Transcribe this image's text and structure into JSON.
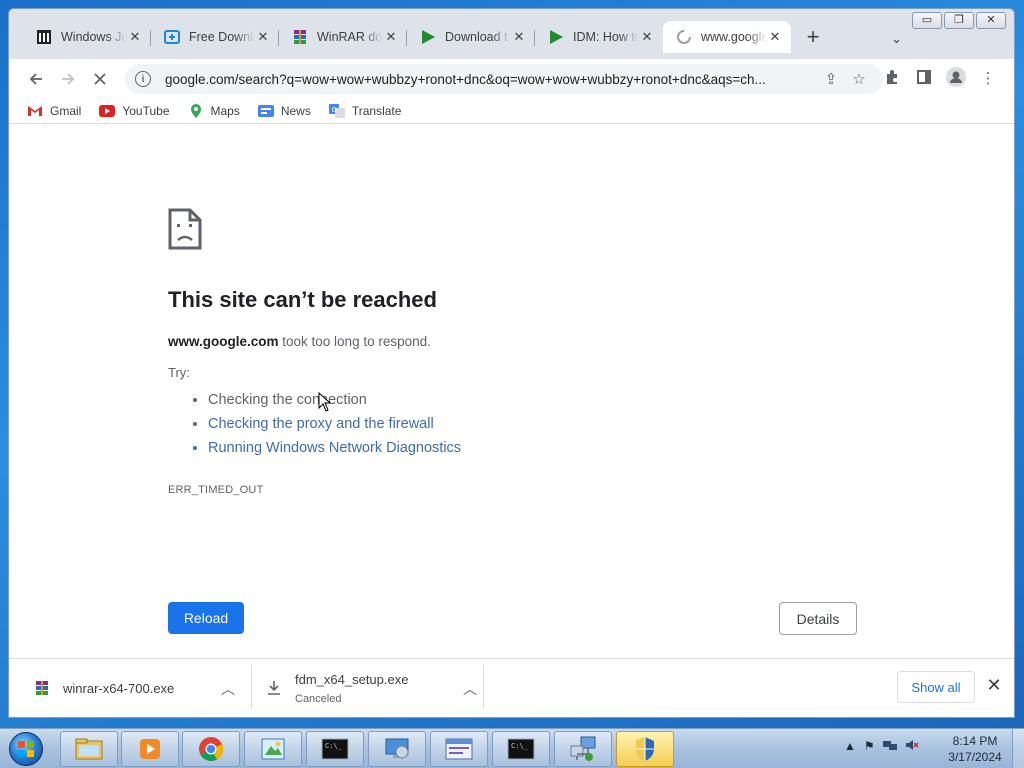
{
  "window_controls": {
    "minimize": "▭",
    "restore": "❐",
    "close": "✕"
  },
  "tabs": [
    {
      "label": "Windows Ju",
      "icon": "museum-icon"
    },
    {
      "label": "Free Downlo",
      "icon": "fdm-icon"
    },
    {
      "label": "WinRAR do",
      "icon": "winrar-icon"
    },
    {
      "label": "Download t",
      "icon": "play-icon"
    },
    {
      "label": "IDM: How to",
      "icon": "play-icon"
    },
    {
      "label": "www.google",
      "icon": "loading-spinner-icon",
      "active": true
    }
  ],
  "toolbar": {
    "url": "google.com/search?q=wow+wow+wubbzy+ronot+dnc&oq=wow+wow+wubbzy+ronot+dnc&aqs=ch..."
  },
  "bookmarks": [
    {
      "label": "Gmail",
      "icon": "gmail-icon"
    },
    {
      "label": "YouTube",
      "icon": "youtube-icon"
    },
    {
      "label": "Maps",
      "icon": "maps-icon"
    },
    {
      "label": "News",
      "icon": "news-icon"
    },
    {
      "label": "Translate",
      "icon": "translate-icon"
    }
  ],
  "error_page": {
    "title": "This site can’t be reached",
    "host": "www.google.com",
    "desc_rest": " took too long to respond.",
    "try_label": "Try:",
    "suggestions": [
      {
        "text": "Checking the connection",
        "link": false
      },
      {
        "text": "Checking the proxy and the firewall",
        "link": true
      },
      {
        "text": "Running Windows Network Diagnostics",
        "link": true
      }
    ],
    "error_code": "ERR_TIMED_OUT",
    "reload_label": "Reload",
    "details_label": "Details"
  },
  "downloads": [
    {
      "name": "winrar-x64-700.exe",
      "status": "",
      "icon": "winrar-icon"
    },
    {
      "name": "fdm_x64_setup.exe",
      "status": "Canceled",
      "icon": "download-icon"
    }
  ],
  "download_shelf": {
    "show_all_label": "Show all"
  },
  "taskbar": {
    "apps": [
      "explorer-icon",
      "media-player-icon",
      "chrome-icon",
      "paint-icon",
      "cmd-icon",
      "remote-desktop-icon",
      "control-panel-icon",
      "cmd-icon",
      "network-icon",
      "uac-shield-icon"
    ],
    "time": "8:14 PM",
    "date": "3/17/2024"
  },
  "colors": {
    "accent": "#1a73e8",
    "link": "#3d6bb5",
    "taskbar": "#a9c2df"
  }
}
